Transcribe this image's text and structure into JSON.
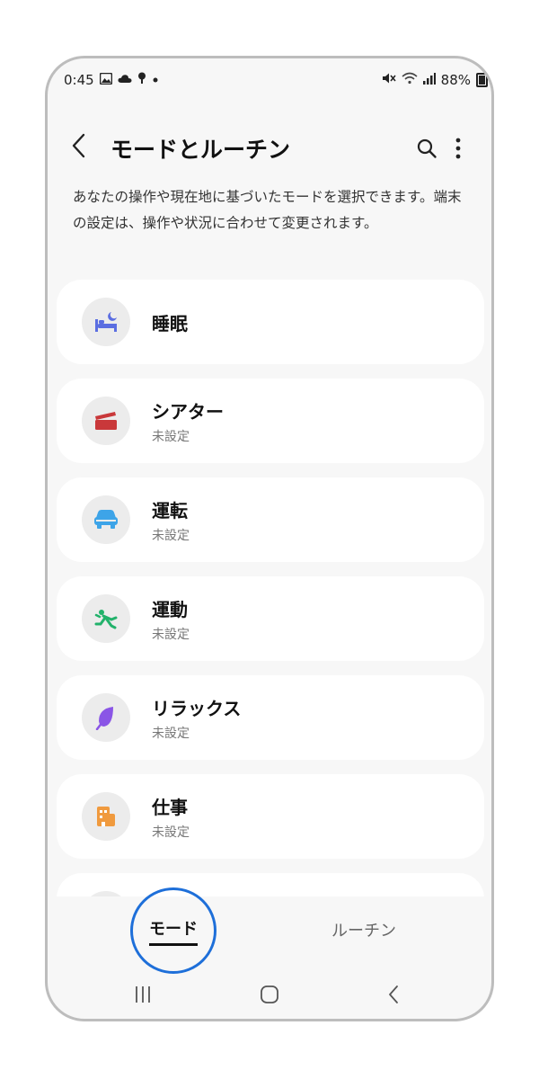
{
  "status_bar": {
    "time": "0:45",
    "battery": "88%",
    "left_icons": [
      "gallery-icon",
      "cloud-icon",
      "location-icon",
      "dot-icon"
    ],
    "right_icons": [
      "mute-icon",
      "wifi-icon",
      "signal-icon",
      "battery-icon"
    ]
  },
  "header": {
    "title": "モードとルーチン"
  },
  "description": "あなたの操作や現在地に基づいたモードを選択できます。端末の設定は、操作や状況に合わせて変更されます。",
  "modes": [
    {
      "title": "睡眠",
      "subtitle": "",
      "icon": "bed-icon",
      "color": "#5b6ee1"
    },
    {
      "title": "シアター",
      "subtitle": "未設定",
      "icon": "clapperboard-icon",
      "color": "#c9383a"
    },
    {
      "title": "運転",
      "subtitle": "未設定",
      "icon": "car-icon",
      "color": "#3da4e8"
    },
    {
      "title": "運動",
      "subtitle": "未設定",
      "icon": "running-icon",
      "color": "#22b26b"
    },
    {
      "title": "リラックス",
      "subtitle": "未設定",
      "icon": "leaf-icon",
      "color": "#8a55e6"
    },
    {
      "title": "仕事",
      "subtitle": "未設定",
      "icon": "building-icon",
      "color": "#f09a3e"
    }
  ],
  "tabs": {
    "modes_label": "モード",
    "routines_label": "ルーチン"
  },
  "colors": {
    "accent_circle": "#1e6fd9"
  }
}
